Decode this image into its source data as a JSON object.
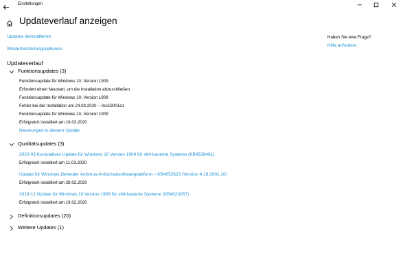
{
  "window": {
    "title": "Einstellungen",
    "colors": {
      "accent": "#1a8fd6",
      "text": "#000000",
      "background": "#ffffff"
    }
  },
  "header": {
    "title": "Updateverlauf anzeigen"
  },
  "actions": {
    "uninstall_link": "Updates deinstallieren",
    "recovery_link": "Wiederherstellungsoptionen"
  },
  "help": {
    "question": "Haben Sie eine Frage?",
    "help_link": "Hilfe anfordern"
  },
  "history": {
    "title": "Updateverlauf",
    "feature": {
      "label": "Funktionsupdates (3)",
      "rows": [
        "Funktionsupdate für Windows 10, Version 1909",
        "Erfordert einen Neustart, um die Installation abzuschließen.",
        "Funktionsupdate für Windows 10, Version 1909",
        "Fehler bei der Installation am 24.03.2020 – 0xc19001e1",
        "Funktionsupdate für Windows 10, Version 1909",
        "Erfolgreich installiert am 16.03.2020"
      ],
      "news_link": "Neuerungen in diesem Update"
    },
    "quality": {
      "label": "Qualitätsupdates (3)",
      "items": [
        {
          "link": "2020-03 Kumulatives Update für Windows 10 Version 1909 für x64-basierte Systeme (KB4538461)",
          "status": "Erfolgreich installiert am 11.03.2020"
        },
        {
          "link": "Update für Windows Defender Antivirus-Antischadsoftwareplattform – KB4052623 (Version 4.18.2001.10)",
          "status": "Erfolgreich installiert am 28.02.2020"
        },
        {
          "link": "2019-12 Update für Windows 10 Version 1909 für x64-basierte Systeme (KB4023057)",
          "status": "Erfolgreich installiert am 19.02.2020"
        }
      ]
    },
    "definition": {
      "label": "Definitionsupdates (20)"
    },
    "other": {
      "label": "Weitere Updates (1)"
    }
  }
}
